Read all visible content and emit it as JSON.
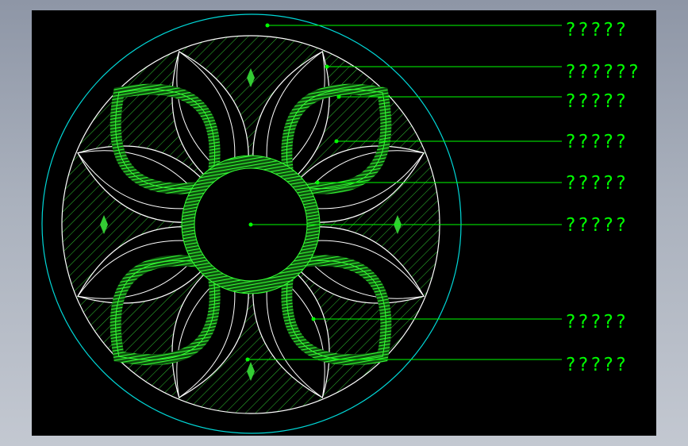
{
  "colors": {
    "background": "#000000",
    "frame": "#9aa1ae",
    "annotation": "#00ff00",
    "outer_circle": "#00d8d8",
    "petal_outline": "#ffffff",
    "hatch_green": "#33ff33"
  },
  "callouts": [
    {
      "label": "?????"
    },
    {
      "label": "??????"
    },
    {
      "label": "?????"
    },
    {
      "label": "?????"
    },
    {
      "label": "?????"
    },
    {
      "label": "?????"
    },
    {
      "label": "?????"
    },
    {
      "label": "?????"
    }
  ]
}
